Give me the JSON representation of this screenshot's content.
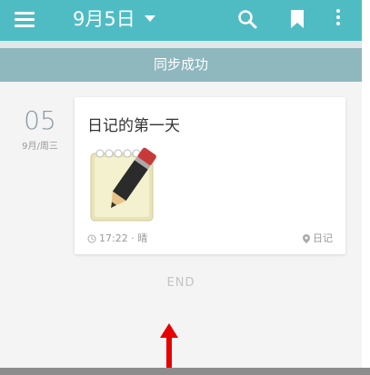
{
  "header": {
    "title": "9月5日",
    "icons": [
      "menu-icon",
      "caret-down-icon",
      "search-icon",
      "bookmark-icon",
      "more-vert-icon"
    ]
  },
  "banner": {
    "text": "同步成功"
  },
  "date": {
    "day": "05",
    "sub": "9月/周三"
  },
  "entry": {
    "title": "日记的第一天",
    "time_weather": "17:22 · 晴",
    "tag": "日记"
  },
  "end_label": "END",
  "colors": {
    "accent": "#4fbcc4",
    "banner": "#8fb7be",
    "arrow": "#e60000"
  }
}
